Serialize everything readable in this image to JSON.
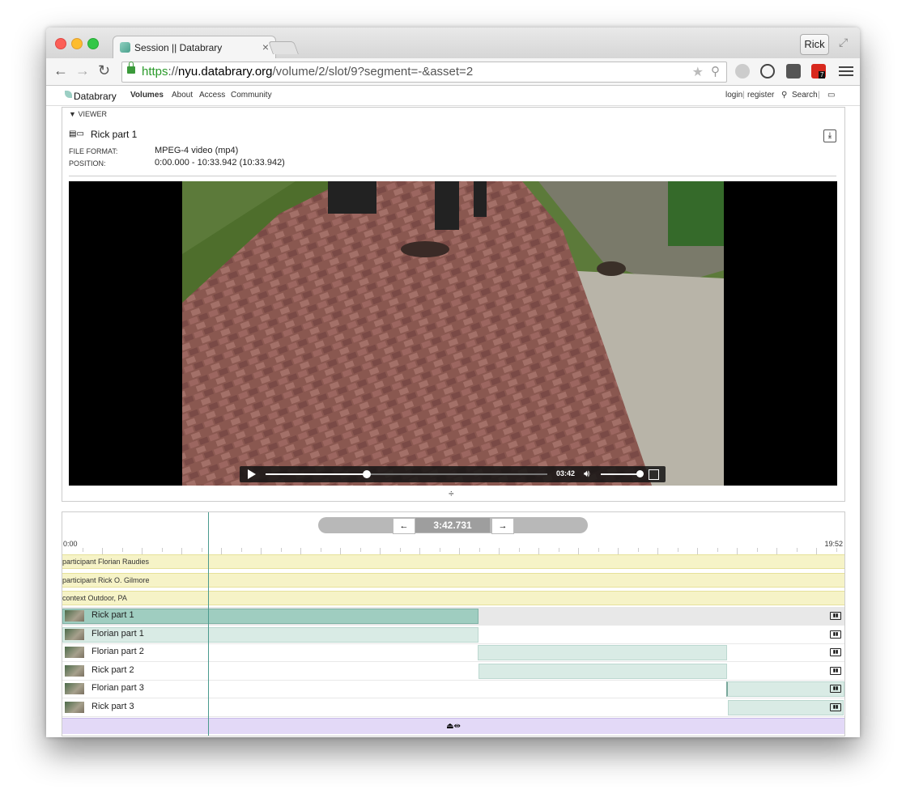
{
  "browser": {
    "tab_title": "Session || Databrary",
    "tab_close": "×",
    "user_button": "Rick",
    "url_scheme": "https",
    "url_sep": "://",
    "url_host": "nyu.databrary.org",
    "url_path": "/volume/2/slot/9?segment=-&asset=2",
    "ext_badge": "7"
  },
  "sitenav": {
    "logo_text": "Databrary",
    "items": [
      "Volumes",
      "About",
      "Access",
      "Community"
    ],
    "login": "login",
    "sep": "|",
    "register": "register",
    "search": "Search",
    "sep2": "|"
  },
  "viewer": {
    "header": "VIEWER",
    "file_title": "Rick part 1",
    "format_label": "FILE FORMAT:",
    "format_value": "MPEG-4 video (mp4)",
    "position_label": "POSITION:",
    "position_value": "0:00.000 - 10:33.942 (10:33.942)",
    "time": "03:42",
    "progress": 0.36,
    "volume": 1.0,
    "resize_glyph": "÷"
  },
  "timeline": {
    "prev": "←",
    "next": "→",
    "position": "3:42.731",
    "start_label": "0:00",
    "end_label": "19:52",
    "records": [
      "participant Florian Raudies",
      "participant Rick O. Gilmore",
      "context Outdoor, PA"
    ],
    "assets": [
      {
        "label": "Rick part 1",
        "selected": true
      },
      {
        "label": "Florian part 1",
        "selected": false
      },
      {
        "label": "Florian part 2",
        "selected": false
      },
      {
        "label": "Rick part 2",
        "selected": false
      },
      {
        "label": "Florian part 3",
        "selected": false
      },
      {
        "label": "Rick part 3",
        "selected": false
      }
    ],
    "footer_glyph": "⏏⇹"
  }
}
